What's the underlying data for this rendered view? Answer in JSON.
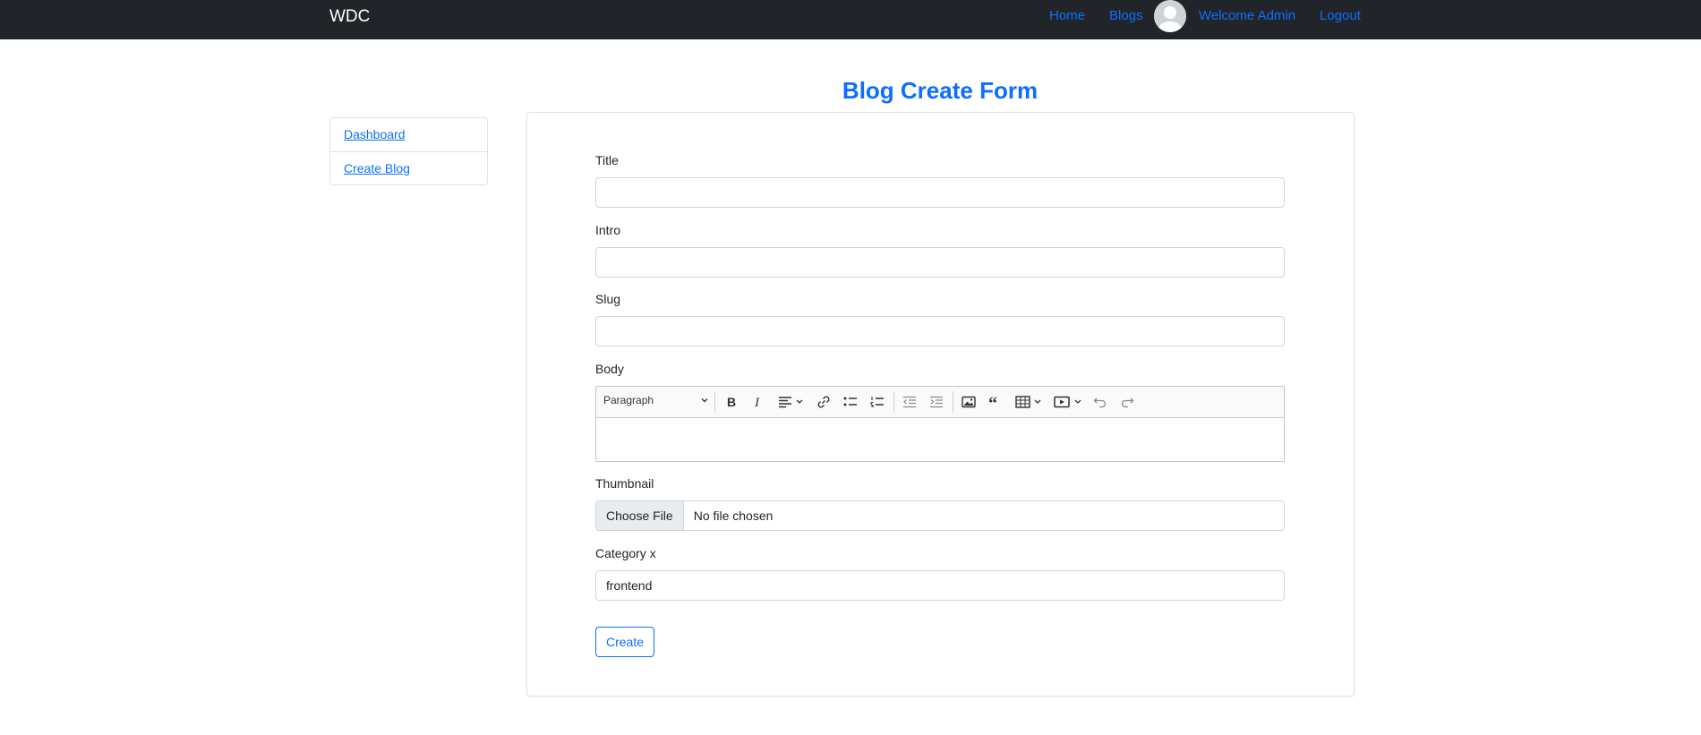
{
  "navbar": {
    "brand": "WDC",
    "links": {
      "home": "Home",
      "blogs": "Blogs",
      "welcome": "Welcome Admin",
      "logout": "Logout"
    }
  },
  "sidebar": {
    "items": [
      {
        "label": "Dashboard"
      },
      {
        "label": "Create Blog"
      }
    ]
  },
  "page": {
    "title": "Blog Create Form"
  },
  "form": {
    "title_label": "Title",
    "title_value": "",
    "intro_label": "Intro",
    "intro_value": "",
    "slug_label": "Slug",
    "slug_value": "",
    "body_label": "Body",
    "editor": {
      "heading_select": "Paragraph",
      "toolbar_icons": [
        "bold-icon",
        "italic-icon",
        "align-icon",
        "link-icon",
        "bulleted-list-icon",
        "numbered-list-icon",
        "outdent-icon",
        "indent-icon",
        "image-icon",
        "quote-icon",
        "table-icon",
        "media-icon",
        "undo-icon",
        "redo-icon"
      ]
    },
    "thumbnail_label": "Thumbnail",
    "thumbnail_button": "Choose File",
    "thumbnail_status": "No file chosen",
    "category_label": "Category x",
    "category_value": "frontend",
    "submit_label": "Create"
  },
  "colors": {
    "navbar_bg": "#212529",
    "link": "#0d6efd",
    "border": "#dee2e6"
  }
}
